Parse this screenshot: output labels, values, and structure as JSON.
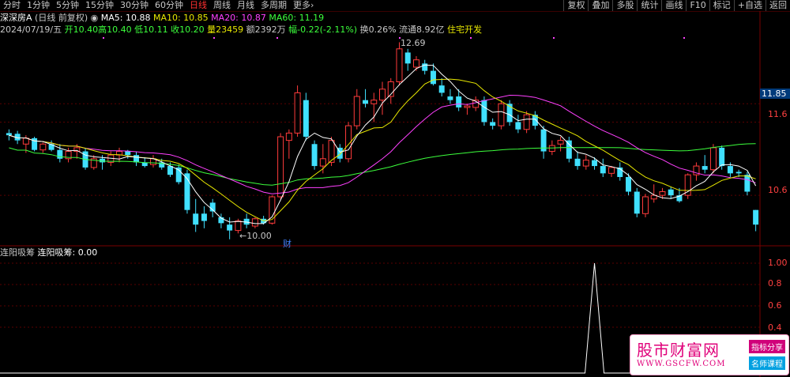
{
  "toolbar": {
    "periods": [
      "分时",
      "1分钟",
      "5分钟",
      "15分钟",
      "30分钟",
      "60分钟",
      "日线",
      "周线",
      "月线",
      "多周期",
      "更多›"
    ],
    "active_period": "日线",
    "tools": [
      "复权",
      "叠加",
      "多股",
      "统计",
      "画线",
      "F10",
      "标记",
      "+自选",
      "返回"
    ]
  },
  "main_header": {
    "stock_name": "深深房A",
    "mode": "(日线 前复权)",
    "ma_icon": "circle-arrow-icon",
    "ma5_label": "MA5: 10.88",
    "ma10_label": "MA10: 10.85",
    "ma20_label": "MA20: 10.87",
    "ma60_label": "MA60: 11.19"
  },
  "quote_line": {
    "date": "2024/07/19/五",
    "open": "开10.40",
    "high": "高10.40",
    "low": "低10.11",
    "close": "收10.20",
    "volume": "量23459",
    "amount": "额2392万",
    "change": "幅-0.22(-2.11%)",
    "turnover": "换0.26%",
    "float_cap": "流通8.92亿",
    "sector": "住宅开发"
  },
  "annotations": {
    "high_mark": "12.69",
    "low_mark": "←10.00",
    "finance_mark": "财"
  },
  "price_axis": {
    "labels": [
      "11.85",
      "11.6",
      "10.6"
    ],
    "last_price": "11.85"
  },
  "sub_indicator": {
    "name": "连阳吸筹",
    "value_label": "连阳吸筹: 0.00",
    "axis_labels": [
      "1.00",
      "0.8",
      "0.6",
      "0.4"
    ]
  },
  "watermark": {
    "logo": "股市财富网",
    "url": "WWW.GSCFW.COM",
    "tag1": "指标分享",
    "tag2": "名师课程"
  },
  "colors": {
    "up": "#ff3b3b",
    "down": "#40e0ff",
    "ma5": "#ffffff",
    "ma10": "#e8e800",
    "ma20": "#ff40ff",
    "ma60": "#3cff3c"
  },
  "chart_data": {
    "type": "candlestick",
    "ylim": [
      9.9,
      12.9
    ],
    "candles": [
      {
        "o": 11.45,
        "h": 11.5,
        "l": 11.35,
        "c": 11.42
      },
      {
        "o": 11.44,
        "h": 11.48,
        "l": 11.3,
        "c": 11.35
      },
      {
        "o": 11.3,
        "h": 11.42,
        "l": 11.18,
        "c": 11.38
      },
      {
        "o": 11.38,
        "h": 11.4,
        "l": 11.2,
        "c": 11.22
      },
      {
        "o": 11.22,
        "h": 11.32,
        "l": 11.18,
        "c": 11.3
      },
      {
        "o": 11.3,
        "h": 11.35,
        "l": 11.2,
        "c": 11.22
      },
      {
        "o": 11.22,
        "h": 11.3,
        "l": 11.05,
        "c": 11.1
      },
      {
        "o": 11.1,
        "h": 11.25,
        "l": 11.05,
        "c": 11.2
      },
      {
        "o": 11.2,
        "h": 11.3,
        "l": 11.1,
        "c": 11.25
      },
      {
        "o": 11.2,
        "h": 11.25,
        "l": 10.95,
        "c": 10.98
      },
      {
        "o": 10.98,
        "h": 11.15,
        "l": 10.95,
        "c": 11.1
      },
      {
        "o": 11.1,
        "h": 11.15,
        "l": 10.95,
        "c": 11.05
      },
      {
        "o": 11.05,
        "h": 11.2,
        "l": 11.0,
        "c": 11.15
      },
      {
        "o": 11.15,
        "h": 11.25,
        "l": 11.05,
        "c": 11.2
      },
      {
        "o": 11.2,
        "h": 11.22,
        "l": 11.1,
        "c": 11.15
      },
      {
        "o": 11.15,
        "h": 11.2,
        "l": 11.0,
        "c": 11.05
      },
      {
        "o": 11.05,
        "h": 11.12,
        "l": 10.98,
        "c": 11.0
      },
      {
        "o": 11.02,
        "h": 11.15,
        "l": 10.98,
        "c": 11.1
      },
      {
        "o": 11.05,
        "h": 11.1,
        "l": 10.95,
        "c": 10.98
      },
      {
        "o": 11.0,
        "h": 11.05,
        "l": 10.85,
        "c": 10.88
      },
      {
        "o": 10.98,
        "h": 11.02,
        "l": 10.75,
        "c": 10.78
      },
      {
        "o": 10.9,
        "h": 10.95,
        "l": 10.35,
        "c": 10.4
      },
      {
        "o": 10.35,
        "h": 10.55,
        "l": 10.1,
        "c": 10.2
      },
      {
        "o": 10.35,
        "h": 10.45,
        "l": 10.15,
        "c": 10.25
      },
      {
        "o": 10.5,
        "h": 10.55,
        "l": 10.3,
        "c": 10.38
      },
      {
        "o": 10.3,
        "h": 10.35,
        "l": 10.15,
        "c": 10.22
      },
      {
        "o": 10.2,
        "h": 10.3,
        "l": 10.0,
        "c": 10.12
      },
      {
        "o": 10.12,
        "h": 10.28,
        "l": 10.08,
        "c": 10.25
      },
      {
        "o": 10.28,
        "h": 10.35,
        "l": 10.15,
        "c": 10.2
      },
      {
        "o": 10.18,
        "h": 10.3,
        "l": 10.15,
        "c": 10.28
      },
      {
        "o": 10.28,
        "h": 10.32,
        "l": 10.2,
        "c": 10.22
      },
      {
        "o": 10.22,
        "h": 10.6,
        "l": 10.2,
        "c": 10.58
      },
      {
        "o": 10.58,
        "h": 11.45,
        "l": 10.55,
        "c": 11.4
      },
      {
        "o": 11.35,
        "h": 11.5,
        "l": 11.1,
        "c": 11.45
      },
      {
        "o": 11.45,
        "h": 12.1,
        "l": 11.4,
        "c": 12.0
      },
      {
        "o": 11.9,
        "h": 12.0,
        "l": 11.35,
        "c": 11.4
      },
      {
        "o": 11.3,
        "h": 11.35,
        "l": 10.95,
        "c": 11.0
      },
      {
        "o": 11.0,
        "h": 11.3,
        "l": 10.9,
        "c": 11.1
      },
      {
        "o": 11.05,
        "h": 11.4,
        "l": 11.0,
        "c": 11.35
      },
      {
        "o": 11.25,
        "h": 11.3,
        "l": 11.05,
        "c": 11.1
      },
      {
        "o": 11.1,
        "h": 11.6,
        "l": 11.05,
        "c": 11.55
      },
      {
        "o": 11.55,
        "h": 12.05,
        "l": 11.5,
        "c": 11.95
      },
      {
        "o": 11.9,
        "h": 12.05,
        "l": 11.8,
        "c": 11.85
      },
      {
        "o": 11.85,
        "h": 12.0,
        "l": 11.6,
        "c": 11.9
      },
      {
        "o": 11.9,
        "h": 12.15,
        "l": 11.7,
        "c": 12.05
      },
      {
        "o": 11.95,
        "h": 12.2,
        "l": 11.85,
        "c": 12.15
      },
      {
        "o": 12.15,
        "h": 12.69,
        "l": 12.1,
        "c": 12.6
      },
      {
        "o": 12.55,
        "h": 12.6,
        "l": 12.3,
        "c": 12.4
      },
      {
        "o": 12.35,
        "h": 12.5,
        "l": 12.3,
        "c": 12.45
      },
      {
        "o": 12.4,
        "h": 12.45,
        "l": 12.25,
        "c": 12.3
      },
      {
        "o": 12.3,
        "h": 12.4,
        "l": 12.1,
        "c": 12.12
      },
      {
        "o": 12.1,
        "h": 12.2,
        "l": 11.95,
        "c": 12.0
      },
      {
        "o": 11.95,
        "h": 12.05,
        "l": 11.85,
        "c": 11.9
      },
      {
        "o": 11.95,
        "h": 12.05,
        "l": 11.75,
        "c": 11.8
      },
      {
        "o": 11.8,
        "h": 11.85,
        "l": 11.7,
        "c": 11.82
      },
      {
        "o": 11.8,
        "h": 11.95,
        "l": 11.75,
        "c": 11.9
      },
      {
        "o": 11.9,
        "h": 11.95,
        "l": 11.55,
        "c": 11.6
      },
      {
        "o": 11.6,
        "h": 11.65,
        "l": 11.5,
        "c": 11.55
      },
      {
        "o": 11.55,
        "h": 11.9,
        "l": 11.5,
        "c": 11.85
      },
      {
        "o": 11.85,
        "h": 11.9,
        "l": 11.55,
        "c": 11.6
      },
      {
        "o": 11.6,
        "h": 11.7,
        "l": 11.45,
        "c": 11.5
      },
      {
        "o": 11.5,
        "h": 11.75,
        "l": 11.45,
        "c": 11.7
      },
      {
        "o": 11.7,
        "h": 11.75,
        "l": 11.5,
        "c": 11.55
      },
      {
        "o": 11.5,
        "h": 11.55,
        "l": 11.1,
        "c": 11.2
      },
      {
        "o": 11.2,
        "h": 11.35,
        "l": 11.15,
        "c": 11.28
      },
      {
        "o": 11.3,
        "h": 11.4,
        "l": 11.2,
        "c": 11.35
      },
      {
        "o": 11.35,
        "h": 11.4,
        "l": 11.05,
        "c": 11.1
      },
      {
        "o": 11.1,
        "h": 11.2,
        "l": 10.95,
        "c": 11.0
      },
      {
        "o": 11.0,
        "h": 11.15,
        "l": 10.95,
        "c": 11.08
      },
      {
        "o": 11.08,
        "h": 11.12,
        "l": 10.95,
        "c": 11.0
      },
      {
        "o": 11.0,
        "h": 11.1,
        "l": 10.85,
        "c": 10.9
      },
      {
        "o": 10.9,
        "h": 11.0,
        "l": 10.85,
        "c": 10.98
      },
      {
        "o": 10.98,
        "h": 11.05,
        "l": 10.8,
        "c": 10.85
      },
      {
        "o": 10.85,
        "h": 10.9,
        "l": 10.6,
        "c": 10.65
      },
      {
        "o": 10.65,
        "h": 10.7,
        "l": 10.3,
        "c": 10.35
      },
      {
        "o": 10.35,
        "h": 10.62,
        "l": 10.3,
        "c": 10.58
      },
      {
        "o": 10.55,
        "h": 10.75,
        "l": 10.5,
        "c": 10.6
      },
      {
        "o": 10.6,
        "h": 10.7,
        "l": 10.55,
        "c": 10.65
      },
      {
        "o": 10.68,
        "h": 10.72,
        "l": 10.55,
        "c": 10.6
      },
      {
        "o": 10.6,
        "h": 10.7,
        "l": 10.5,
        "c": 10.52
      },
      {
        "o": 10.6,
        "h": 10.9,
        "l": 10.55,
        "c": 10.88
      },
      {
        "o": 10.88,
        "h": 11.05,
        "l": 10.8,
        "c": 11.0
      },
      {
        "o": 11.0,
        "h": 11.15,
        "l": 10.9,
        "c": 10.95
      },
      {
        "o": 10.95,
        "h": 11.3,
        "l": 10.9,
        "c": 11.25
      },
      {
        "o": 11.25,
        "h": 11.28,
        "l": 10.95,
        "c": 11.0
      },
      {
        "o": 11.0,
        "h": 11.05,
        "l": 10.85,
        "c": 10.9
      },
      {
        "o": 10.92,
        "h": 10.95,
        "l": 10.85,
        "c": 10.9
      },
      {
        "o": 10.88,
        "h": 10.92,
        "l": 10.6,
        "c": 10.65
      },
      {
        "o": 10.4,
        "h": 10.4,
        "l": 10.11,
        "c": 10.2
      }
    ],
    "indicator_values": {
      "spike_index": 69,
      "spike_value": 1.0
    }
  }
}
